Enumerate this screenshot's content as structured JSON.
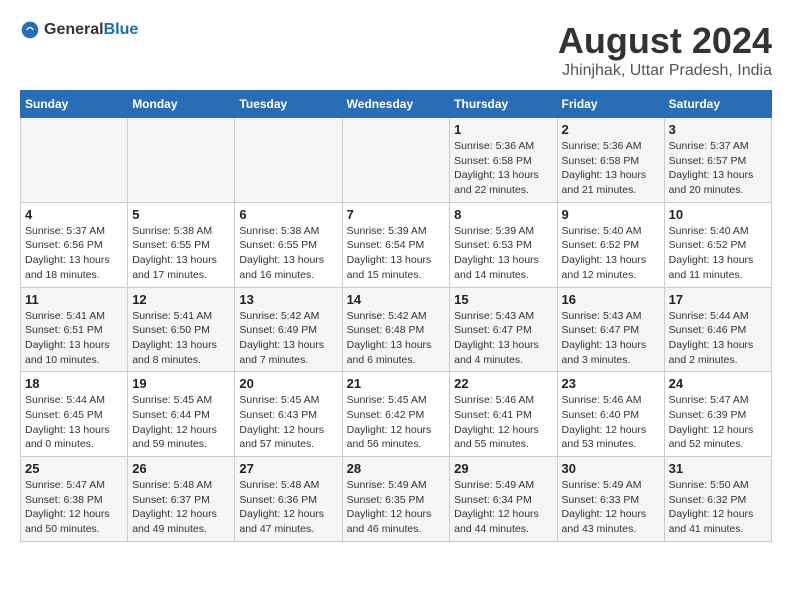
{
  "logo": {
    "general": "General",
    "blue": "Blue"
  },
  "title": "August 2024",
  "subtitle": "Jhinjhak, Uttar Pradesh, India",
  "days_of_week": [
    "Sunday",
    "Monday",
    "Tuesday",
    "Wednesday",
    "Thursday",
    "Friday",
    "Saturday"
  ],
  "weeks": [
    [
      {
        "day": "",
        "detail": ""
      },
      {
        "day": "",
        "detail": ""
      },
      {
        "day": "",
        "detail": ""
      },
      {
        "day": "",
        "detail": ""
      },
      {
        "day": "1",
        "detail": "Sunrise: 5:36 AM\nSunset: 6:58 PM\nDaylight: 13 hours\nand 22 minutes."
      },
      {
        "day": "2",
        "detail": "Sunrise: 5:36 AM\nSunset: 6:58 PM\nDaylight: 13 hours\nand 21 minutes."
      },
      {
        "day": "3",
        "detail": "Sunrise: 5:37 AM\nSunset: 6:57 PM\nDaylight: 13 hours\nand 20 minutes."
      }
    ],
    [
      {
        "day": "4",
        "detail": "Sunrise: 5:37 AM\nSunset: 6:56 PM\nDaylight: 13 hours\nand 18 minutes."
      },
      {
        "day": "5",
        "detail": "Sunrise: 5:38 AM\nSunset: 6:55 PM\nDaylight: 13 hours\nand 17 minutes."
      },
      {
        "day": "6",
        "detail": "Sunrise: 5:38 AM\nSunset: 6:55 PM\nDaylight: 13 hours\nand 16 minutes."
      },
      {
        "day": "7",
        "detail": "Sunrise: 5:39 AM\nSunset: 6:54 PM\nDaylight: 13 hours\nand 15 minutes."
      },
      {
        "day": "8",
        "detail": "Sunrise: 5:39 AM\nSunset: 6:53 PM\nDaylight: 13 hours\nand 14 minutes."
      },
      {
        "day": "9",
        "detail": "Sunrise: 5:40 AM\nSunset: 6:52 PM\nDaylight: 13 hours\nand 12 minutes."
      },
      {
        "day": "10",
        "detail": "Sunrise: 5:40 AM\nSunset: 6:52 PM\nDaylight: 13 hours\nand 11 minutes."
      }
    ],
    [
      {
        "day": "11",
        "detail": "Sunrise: 5:41 AM\nSunset: 6:51 PM\nDaylight: 13 hours\nand 10 minutes."
      },
      {
        "day": "12",
        "detail": "Sunrise: 5:41 AM\nSunset: 6:50 PM\nDaylight: 13 hours\nand 8 minutes."
      },
      {
        "day": "13",
        "detail": "Sunrise: 5:42 AM\nSunset: 6:49 PM\nDaylight: 13 hours\nand 7 minutes."
      },
      {
        "day": "14",
        "detail": "Sunrise: 5:42 AM\nSunset: 6:48 PM\nDaylight: 13 hours\nand 6 minutes."
      },
      {
        "day": "15",
        "detail": "Sunrise: 5:43 AM\nSunset: 6:47 PM\nDaylight: 13 hours\nand 4 minutes."
      },
      {
        "day": "16",
        "detail": "Sunrise: 5:43 AM\nSunset: 6:47 PM\nDaylight: 13 hours\nand 3 minutes."
      },
      {
        "day": "17",
        "detail": "Sunrise: 5:44 AM\nSunset: 6:46 PM\nDaylight: 13 hours\nand 2 minutes."
      }
    ],
    [
      {
        "day": "18",
        "detail": "Sunrise: 5:44 AM\nSunset: 6:45 PM\nDaylight: 13 hours\nand 0 minutes."
      },
      {
        "day": "19",
        "detail": "Sunrise: 5:45 AM\nSunset: 6:44 PM\nDaylight: 12 hours\nand 59 minutes."
      },
      {
        "day": "20",
        "detail": "Sunrise: 5:45 AM\nSunset: 6:43 PM\nDaylight: 12 hours\nand 57 minutes."
      },
      {
        "day": "21",
        "detail": "Sunrise: 5:45 AM\nSunset: 6:42 PM\nDaylight: 12 hours\nand 56 minutes."
      },
      {
        "day": "22",
        "detail": "Sunrise: 5:46 AM\nSunset: 6:41 PM\nDaylight: 12 hours\nand 55 minutes."
      },
      {
        "day": "23",
        "detail": "Sunrise: 5:46 AM\nSunset: 6:40 PM\nDaylight: 12 hours\nand 53 minutes."
      },
      {
        "day": "24",
        "detail": "Sunrise: 5:47 AM\nSunset: 6:39 PM\nDaylight: 12 hours\nand 52 minutes."
      }
    ],
    [
      {
        "day": "25",
        "detail": "Sunrise: 5:47 AM\nSunset: 6:38 PM\nDaylight: 12 hours\nand 50 minutes."
      },
      {
        "day": "26",
        "detail": "Sunrise: 5:48 AM\nSunset: 6:37 PM\nDaylight: 12 hours\nand 49 minutes."
      },
      {
        "day": "27",
        "detail": "Sunrise: 5:48 AM\nSunset: 6:36 PM\nDaylight: 12 hours\nand 47 minutes."
      },
      {
        "day": "28",
        "detail": "Sunrise: 5:49 AM\nSunset: 6:35 PM\nDaylight: 12 hours\nand 46 minutes."
      },
      {
        "day": "29",
        "detail": "Sunrise: 5:49 AM\nSunset: 6:34 PM\nDaylight: 12 hours\nand 44 minutes."
      },
      {
        "day": "30",
        "detail": "Sunrise: 5:49 AM\nSunset: 6:33 PM\nDaylight: 12 hours\nand 43 minutes."
      },
      {
        "day": "31",
        "detail": "Sunrise: 5:50 AM\nSunset: 6:32 PM\nDaylight: 12 hours\nand 41 minutes."
      }
    ]
  ]
}
